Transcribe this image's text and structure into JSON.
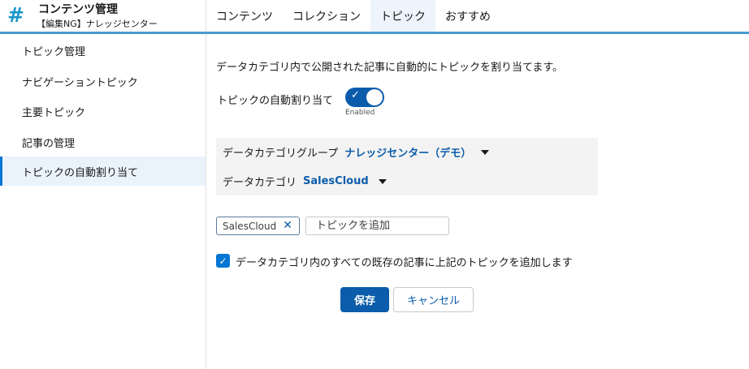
{
  "header": {
    "icon": "#",
    "title": "コンテンツ管理",
    "subtitle": "【編集NG】ナレッジセンター"
  },
  "tabs": [
    {
      "label": "コンテンツ",
      "active": false
    },
    {
      "label": "コレクション",
      "active": false
    },
    {
      "label": "トピック",
      "active": true
    },
    {
      "label": "おすすめ",
      "active": false
    }
  ],
  "sidebar": {
    "items": [
      {
        "label": "トピック管理",
        "active": false
      },
      {
        "label": "ナビゲーショントピック",
        "active": false
      },
      {
        "label": "主要トピック",
        "active": false
      },
      {
        "label": "記事の管理",
        "active": false
      },
      {
        "label": "トピックの自動割り当て",
        "active": true
      }
    ]
  },
  "main": {
    "description": "データカテゴリ内で公開された記事に自動的にトピックを割り当てます。",
    "toggle": {
      "label": "トピックの自動割り当て",
      "state_label": "Enabled",
      "check_glyph": "✓",
      "on": true
    },
    "category_group": {
      "label": "データカテゴリグループ",
      "value": "ナレッジセンター（デモ）"
    },
    "category": {
      "label": "データカテゴリ",
      "value": "SalesCloud"
    },
    "pill": {
      "label": "SalesCloud",
      "remove_glyph": "✕"
    },
    "topic_input": {
      "placeholder": "トピックを追加",
      "value": ""
    },
    "checkbox": {
      "label": "データカテゴリ内のすべての既存の記事に上記のトピックを追加します",
      "checked": true,
      "glyph": "✓"
    },
    "save_label": "保存",
    "cancel_label": "キャンセル"
  },
  "colors": {
    "brand": "#0b5cab",
    "accent": "#0176d3",
    "header_rule": "#4b9bd1",
    "icon": "#1b96c8"
  }
}
